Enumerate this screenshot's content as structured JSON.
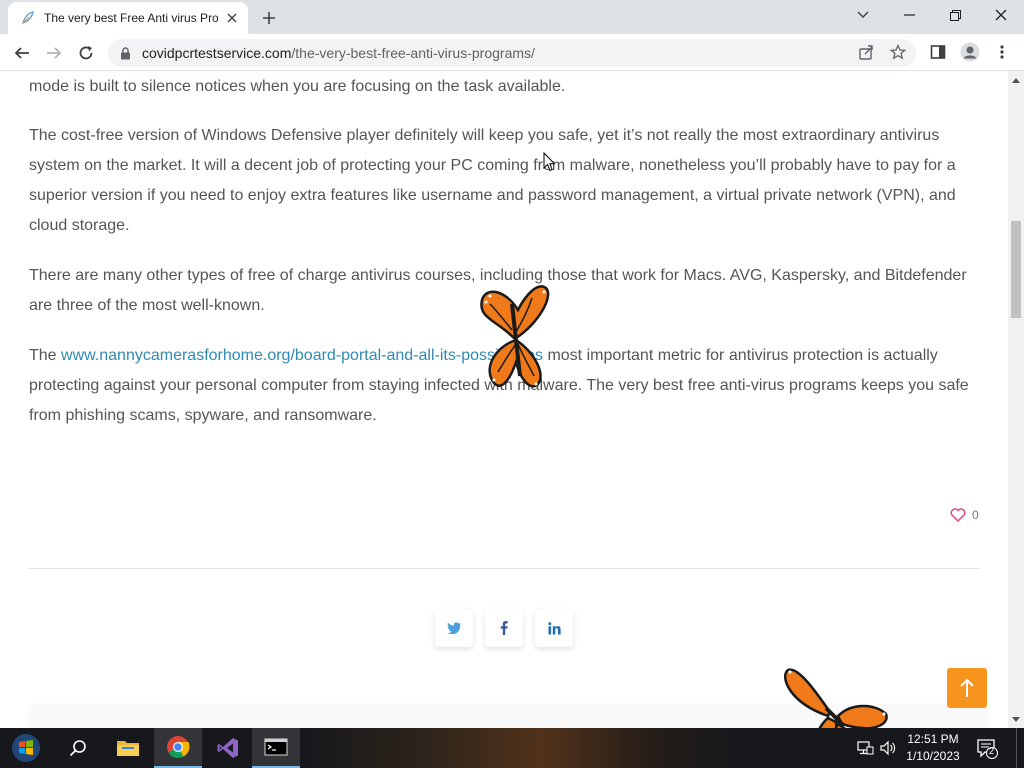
{
  "browser": {
    "tab_title": "The very best Free Anti virus Prog",
    "url_domain": "covidpcrtestservice.com",
    "url_path": "/the-very-best-free-anti-virus-programs/"
  },
  "article": {
    "p0": "mode is built to silence notices when you are focusing on the task available.",
    "p1": "The cost-free version of Windows Defensive player definitely will keep you safe, yet it’s not really the most extraordinary antivirus system on the market. It will a decent job of protecting your PC coming from malware, nonetheless you’ll probably have to pay for a superior version if you need to enjoy extra features like username and password management, a virtual private network (VPN), and cloud storage.",
    "p2": "There are many other types of free of charge antivirus courses, including those that work for Macs. AVG, Kaspersky, and Bitdefender are three of the most well-known.",
    "p3_before": "The ",
    "p3_link": "www.nannycamerasforhome.org/board-portal-and-all-its-possibilities",
    "p3_after": " most important metric for antivirus protection is actually protecting against your personal computer from staying infected with malware. The very best free anti-virus programs keeps you safe from phishing scams, spyware, and ransomware."
  },
  "likes": {
    "count": "0"
  },
  "share": {
    "icons": [
      "twitter-icon",
      "facebook-icon",
      "linkedin-icon"
    ]
  },
  "taskbar": {
    "time": "12:51 PM",
    "date": "1/10/2023",
    "notification_count": "2",
    "apps": [
      "start",
      "search",
      "file-explorer",
      "chrome",
      "visual-studio",
      "terminal"
    ]
  },
  "colors": {
    "accent_orange": "#f7941d",
    "link_blue": "#2f8ab3",
    "heart_pink": "#e2467a"
  }
}
